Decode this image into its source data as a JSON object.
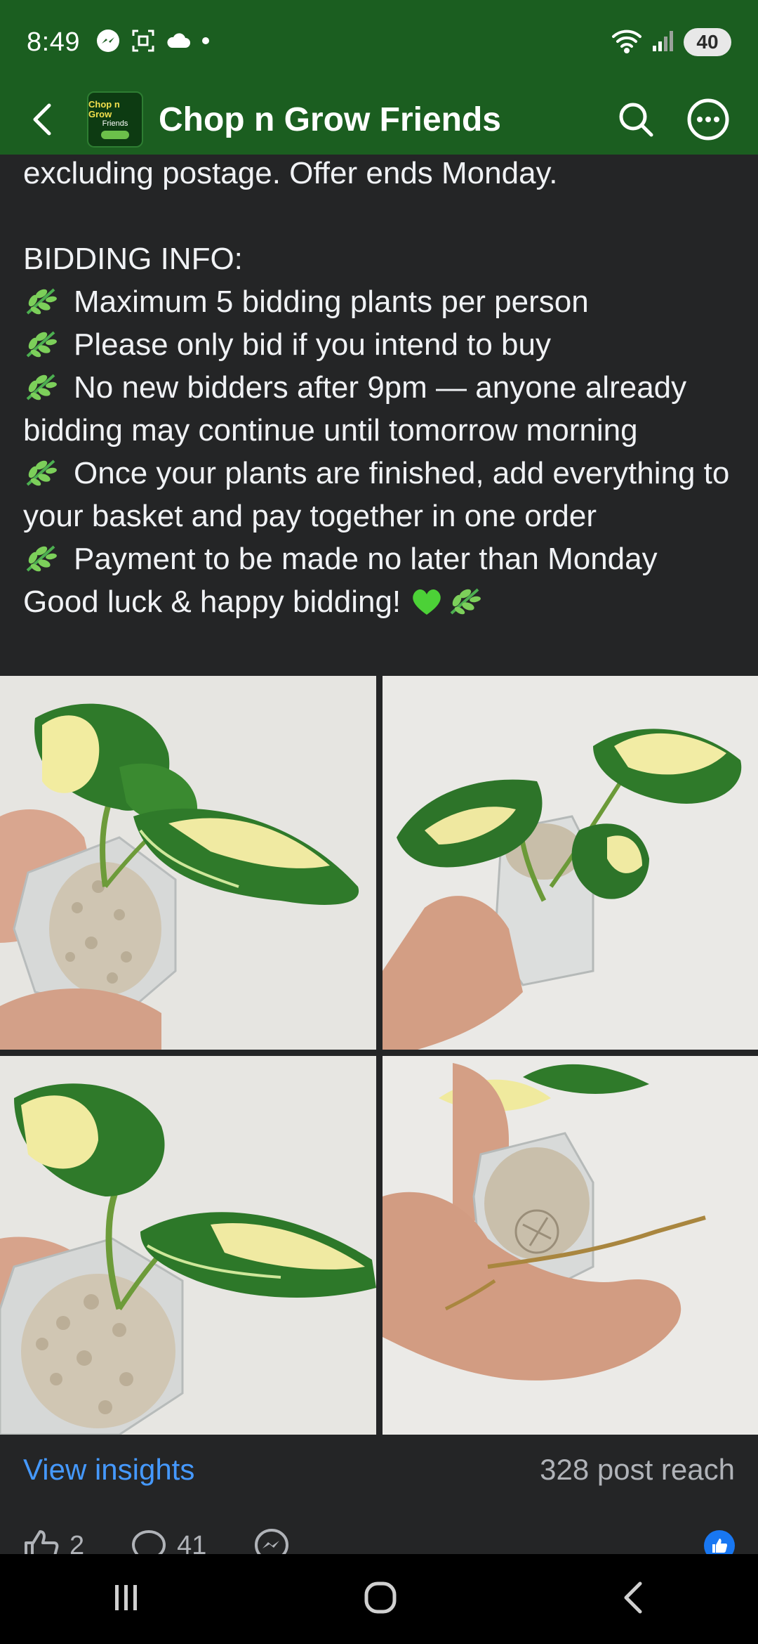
{
  "status_bar": {
    "time": "8:49",
    "battery": "40",
    "icons_left": [
      "messenger-icon",
      "screenshot-icon",
      "cloud-icon",
      "dot-icon"
    ],
    "icons_right": [
      "wifi-icon",
      "signal-icon",
      "battery-icon"
    ]
  },
  "header": {
    "title": "Chop n Grow Friends",
    "avatar_line1": "Chop n Grow",
    "avatar_line2": "Friends",
    "background": "#1b5e20"
  },
  "post": {
    "lines": [
      "excluding postage. Offer ends Monday.",
      "BIDDING INFO:",
      "Maximum 5 bidding plants per person",
      "Please only bid if you intend to buy",
      "No new bidders after 9pm — anyone already bidding may continue until tomorrow morning",
      "Once your plants are finished, add everything to your basket and pay together in one order",
      "Payment to be made no later than Monday",
      "Good luck & happy bidding!"
    ]
  },
  "photos": [
    {
      "alt": "variegated plant in hexagon pot, view 1"
    },
    {
      "alt": "variegated plant held in hand, view 2"
    },
    {
      "alt": "variegated plant in hexagon pot, view 3"
    },
    {
      "alt": "underside of pot with roots, view 4"
    }
  ],
  "insights": {
    "link": "View insights",
    "reach": "328 post reach"
  },
  "reactions": {
    "likes": "2",
    "comments": "41"
  },
  "colors": {
    "accent_link": "#4599ff",
    "leaf_green": "#6cc04a",
    "heart_green": "#4cd137",
    "like_blue": "#1877f2"
  }
}
